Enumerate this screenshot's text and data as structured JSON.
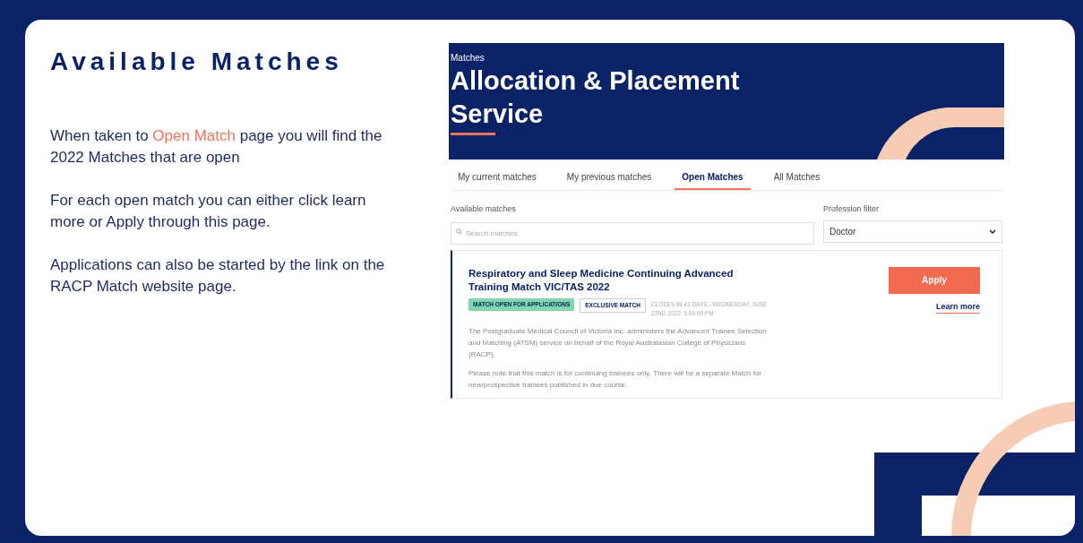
{
  "slide": {
    "title": "Available Matches",
    "paragraphs": [
      [
        {
          "text": "When taken to ",
          "highlight": false
        },
        {
          "text": "Open Match",
          "highlight": true
        },
        {
          "text": " page you will find the 2022 Matches that are open",
          "highlight": false
        }
      ],
      [
        {
          "text": "For each open match you can either click learn more or Apply through this page.",
          "highlight": false
        }
      ],
      [
        {
          "text": "Applications can also be started by the link on the RACP Match website page.",
          "highlight": false
        }
      ]
    ]
  },
  "screenshot": {
    "breadcrumb": "Matches",
    "title": "Allocation & Placement Service",
    "tabs": [
      {
        "label": "My current matches",
        "selected": false
      },
      {
        "label": "My previous matches",
        "selected": false
      },
      {
        "label": "Open Matches",
        "selected": true
      },
      {
        "label": "All Matches",
        "selected": false
      }
    ],
    "search": {
      "label": "Available matches",
      "placeholder": "Search matches"
    },
    "filter": {
      "label": "Profession filter",
      "value": "Doctor"
    },
    "matches": [
      {
        "title": "Respiratory and Sleep Medicine Continuing Advanced Training Match VIC/TAS 2022",
        "tags": [
          {
            "label": "MATCH OPEN FOR APPLICATIONS",
            "kind": "status"
          },
          {
            "label": "EXCLUSIVE MATCH",
            "kind": "outline"
          }
        ],
        "closes": "CLOSES IN 43 DAYS - WEDNESDAY, JUNE 22ND 2022, 5:00:00 PM",
        "description": [
          "The Postgraduate Medical Council of Victoria Inc. administers the Advanced Trainee Selection and Matching (ATSM) service on behalf of the Royal Australasian College of Physicians (RACP).",
          "Please note that this match is for continuing trainees only. There will be a separate Match for new/prospective trainees published in due course."
        ],
        "apply": "Apply",
        "learn_more": "Learn more"
      }
    ]
  }
}
